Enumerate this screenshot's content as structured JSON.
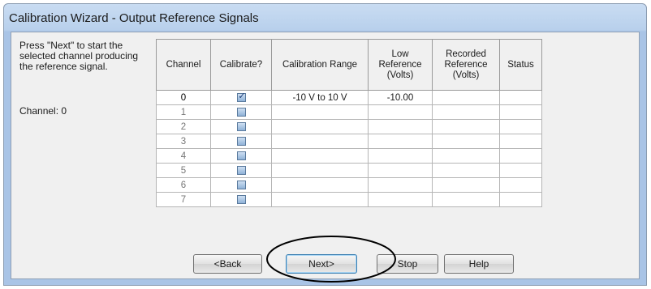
{
  "window": {
    "title": "Calibration Wizard - Output Reference Signals"
  },
  "instructions": {
    "text": "Press \"Next\" to start the selected channel producing the reference signal.",
    "channel_label": "Channel: 0"
  },
  "table": {
    "columns": [
      "Channel",
      "Calibrate?",
      "Calibration Range",
      "Low Reference (Volts)",
      "Recorded Reference (Volts)",
      "Status"
    ],
    "rows": [
      {
        "channel": "0",
        "calibrate": true,
        "range": "-10 V to 10 V",
        "low_reference": "-10.00",
        "recorded_reference": "",
        "status": ""
      },
      {
        "channel": "1",
        "calibrate": false,
        "range": "",
        "low_reference": "",
        "recorded_reference": "",
        "status": ""
      },
      {
        "channel": "2",
        "calibrate": false,
        "range": "",
        "low_reference": "",
        "recorded_reference": "",
        "status": ""
      },
      {
        "channel": "3",
        "calibrate": false,
        "range": "",
        "low_reference": "",
        "recorded_reference": "",
        "status": ""
      },
      {
        "channel": "4",
        "calibrate": false,
        "range": "",
        "low_reference": "",
        "recorded_reference": "",
        "status": ""
      },
      {
        "channel": "5",
        "calibrate": false,
        "range": "",
        "low_reference": "",
        "recorded_reference": "",
        "status": ""
      },
      {
        "channel": "6",
        "calibrate": false,
        "range": "",
        "low_reference": "",
        "recorded_reference": "",
        "status": ""
      },
      {
        "channel": "7",
        "calibrate": false,
        "range": "",
        "low_reference": "",
        "recorded_reference": "",
        "status": ""
      }
    ]
  },
  "buttons": {
    "back": "<Back",
    "next": "Next>",
    "stop": "Stop",
    "help": "Help"
  },
  "icons": {
    "checkbox_checked": "checkmark-icon"
  },
  "colors": {
    "titlebar": "#b8d0ec",
    "dialog_background": "#f0f0f0",
    "highlight_ellipse": "#000000"
  }
}
